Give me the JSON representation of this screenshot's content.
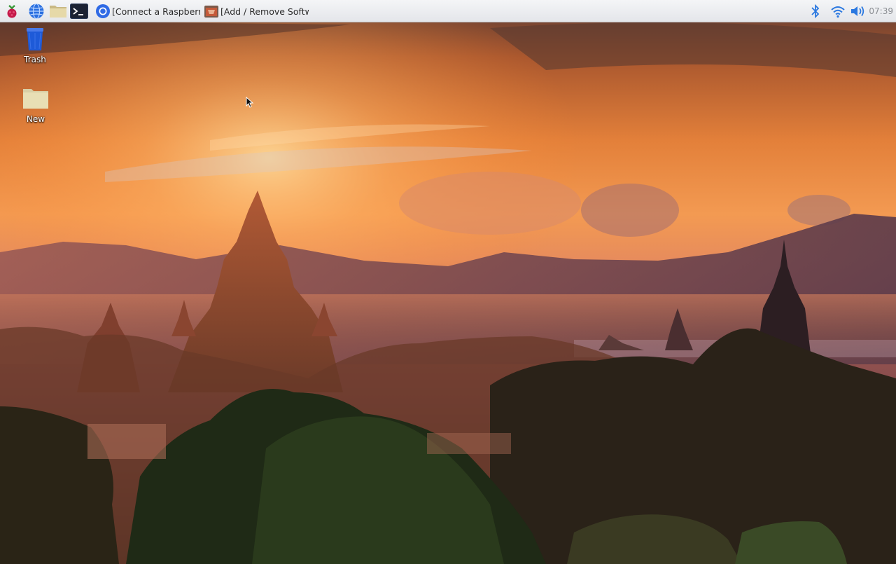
{
  "taskbar": {
    "launchers": [
      {
        "icon": "raspberry-menu-icon"
      },
      {
        "icon": "web-browser-globe-icon"
      },
      {
        "icon": "file-manager-folder-icon"
      },
      {
        "icon": "terminal-icon"
      }
    ],
    "tasks": [
      {
        "label": "[Connect a Raspberry...",
        "icon": "chromium-icon"
      },
      {
        "label": "[Add / Remove Softw...",
        "icon": "software-installer-icon"
      }
    ],
    "tray": [
      {
        "icon": "bluetooth-icon"
      },
      {
        "icon": "wifi-icon"
      },
      {
        "icon": "volume-icon"
      }
    ],
    "clock": "07:39"
  },
  "desktop": {
    "icons": [
      {
        "label": "Trash",
        "icon": "trash-icon"
      },
      {
        "label": "New",
        "icon": "folder-icon"
      }
    ]
  },
  "colors": {
    "taskbar_bg": "#eef0f3",
    "sky_top": "#3a2a2a",
    "sky_glow": "#f08a3a",
    "foliage": "#1f2a18"
  }
}
